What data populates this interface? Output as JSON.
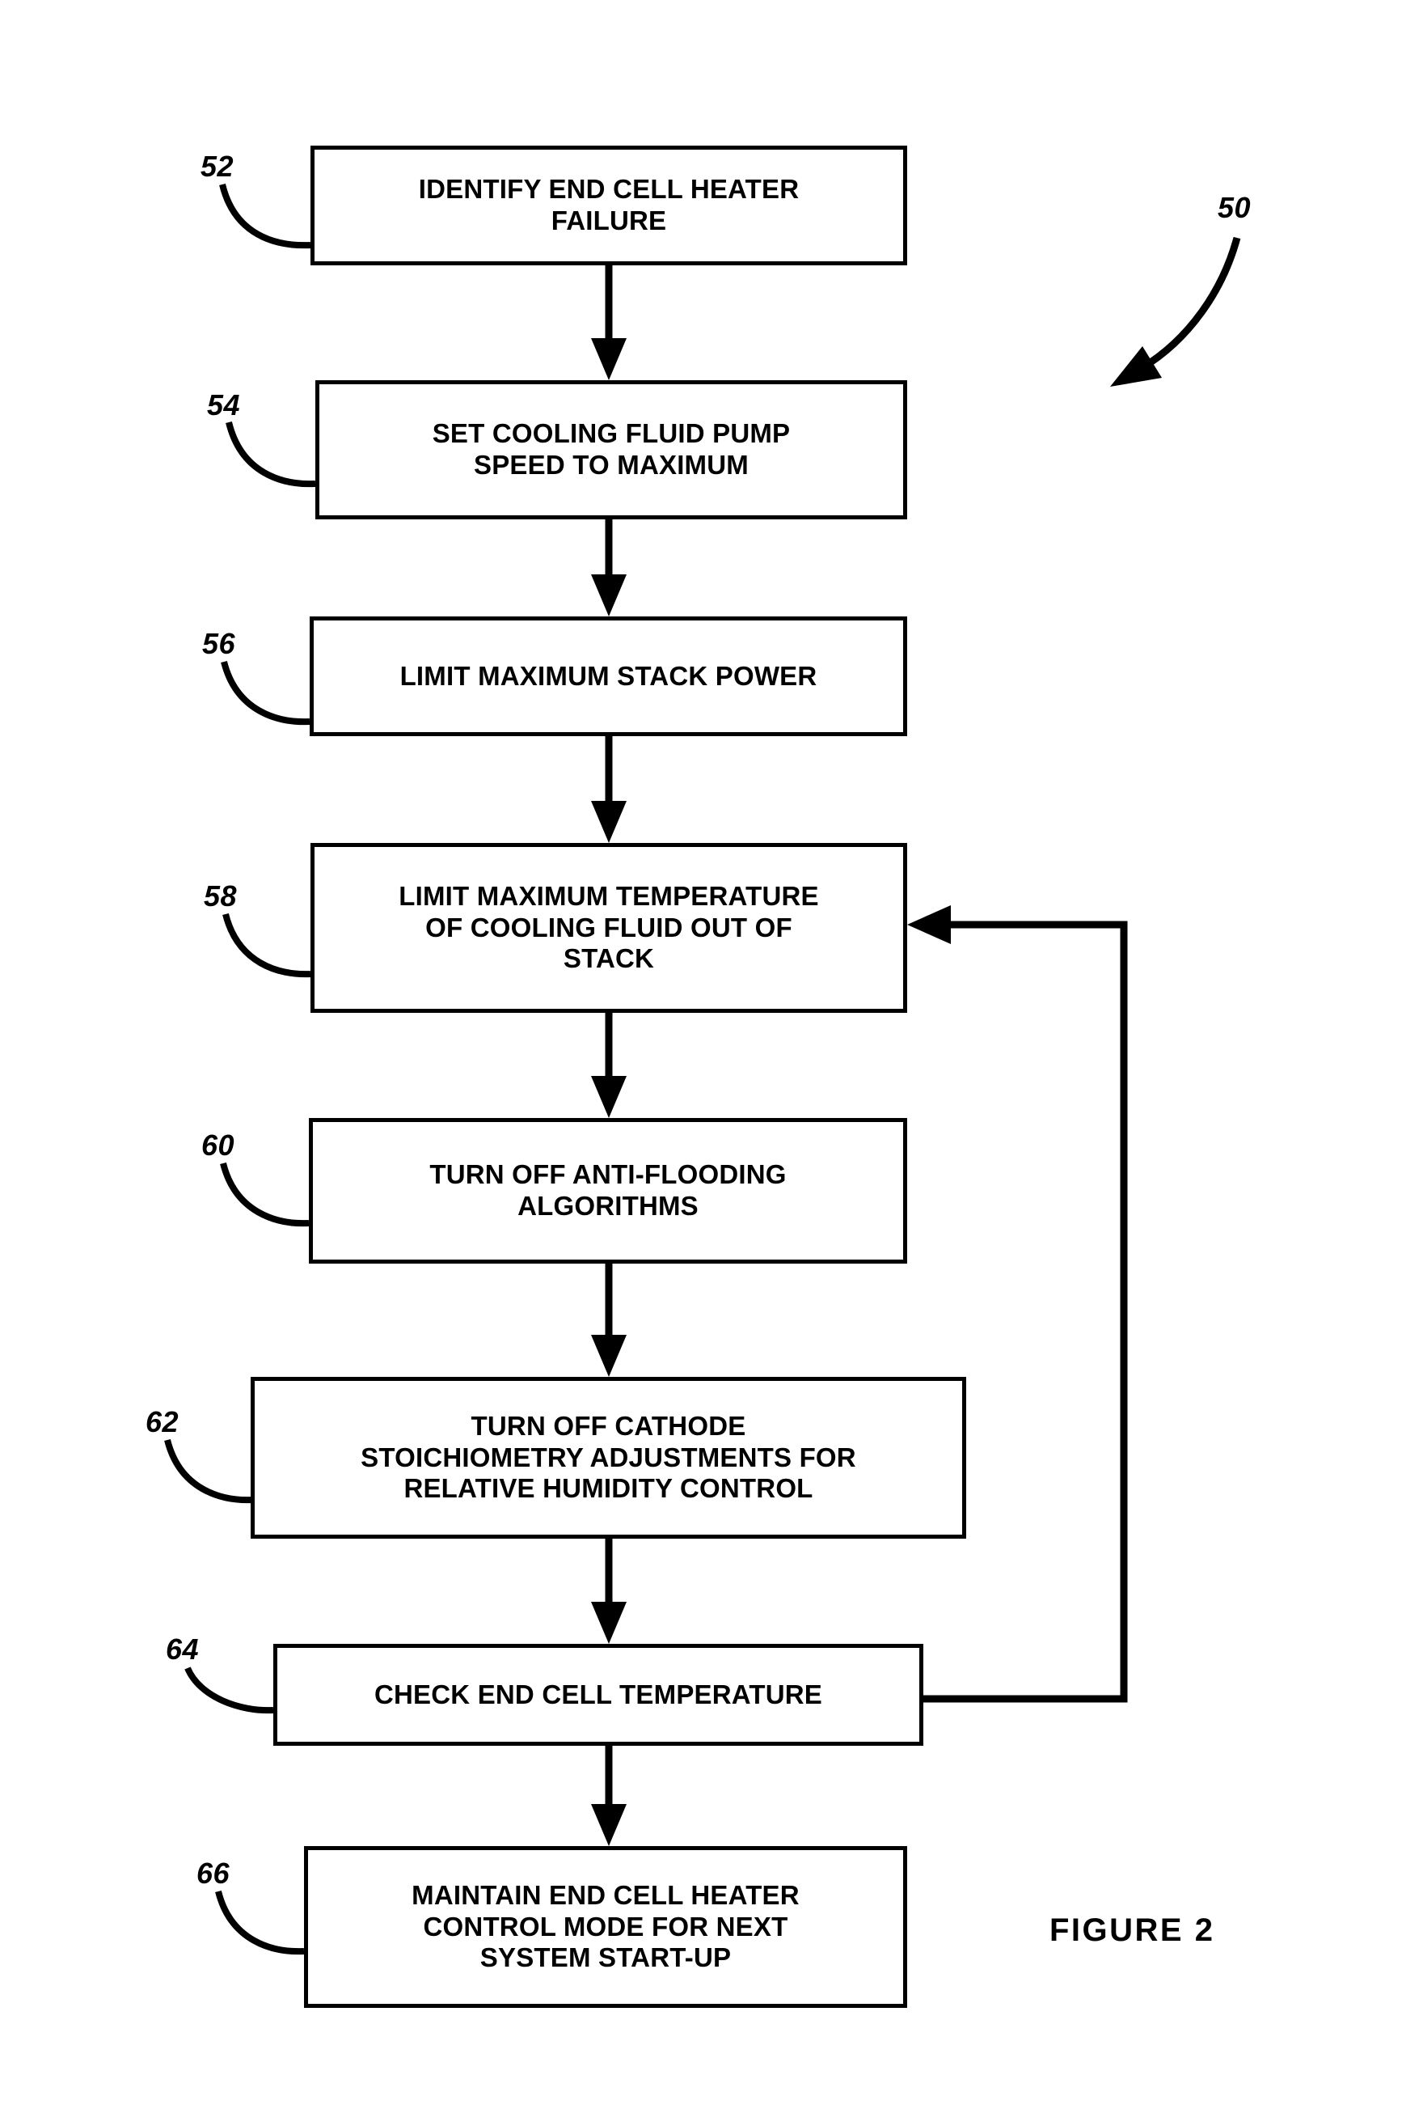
{
  "figure": {
    "caption": "FIGURE  2",
    "overall_reference": "50"
  },
  "flowchart": {
    "type": "flowchart",
    "orientation": "top-to-bottom",
    "steps": [
      {
        "ref": "52",
        "text": "IDENTIFY END CELL HEATER\nFAILURE",
        "lines": [
          "IDENTIFY END CELL HEATER",
          "FAILURE"
        ]
      },
      {
        "ref": "54",
        "text": "SET COOLING FLUID PUMP\nSPEED TO MAXIMUM",
        "lines": [
          "SET COOLING FLUID PUMP",
          "SPEED TO MAXIMUM"
        ]
      },
      {
        "ref": "56",
        "text": "LIMIT MAXIMUM STACK POWER",
        "lines": [
          "LIMIT MAXIMUM STACK POWER"
        ]
      },
      {
        "ref": "58",
        "text": "LIMIT MAXIMUM TEMPERATURE\nOF COOLING FLUID OUT OF\nSTACK",
        "lines": [
          "LIMIT MAXIMUM TEMPERATURE",
          "OF COOLING FLUID OUT OF",
          "STACK"
        ]
      },
      {
        "ref": "60",
        "text": "TURN OFF ANTI-FLOODING\nALGORITHMS",
        "lines": [
          "TURN OFF ANTI-FLOODING",
          "ALGORITHMS"
        ]
      },
      {
        "ref": "62",
        "text": "TURN OFF CATHODE\nSTOICHIOMETRY ADJUSTMENTS FOR\nRELATIVE HUMIDITY CONTROL",
        "lines": [
          "TURN OFF CATHODE",
          "STOICHIOMETRY ADJUSTMENTS FOR",
          "RELATIVE HUMIDITY CONTROL"
        ]
      },
      {
        "ref": "64",
        "text": "CHECK END CELL TEMPERATURE",
        "lines": [
          "CHECK END CELL TEMPERATURE"
        ]
      },
      {
        "ref": "66",
        "text": "MAINTAIN END CELL HEATER\nCONTROL MODE FOR NEXT\nSYSTEM START-UP",
        "lines": [
          "MAINTAIN END CELL HEATER",
          "CONTROL MODE FOR NEXT",
          "SYSTEM START-UP"
        ]
      }
    ],
    "connections": [
      {
        "from": "52",
        "to": "54",
        "kind": "down-arrow"
      },
      {
        "from": "54",
        "to": "56",
        "kind": "down-arrow"
      },
      {
        "from": "56",
        "to": "58",
        "kind": "down-arrow"
      },
      {
        "from": "58",
        "to": "60",
        "kind": "down-arrow"
      },
      {
        "from": "60",
        "to": "62",
        "kind": "down-arrow"
      },
      {
        "from": "62",
        "to": "64",
        "kind": "down-arrow"
      },
      {
        "from": "64",
        "to": "66",
        "kind": "down-arrow"
      },
      {
        "from": "64",
        "to": "58",
        "kind": "feedback-loop-right"
      }
    ]
  },
  "colors": {
    "ink": "#000000",
    "paper": "#ffffff"
  }
}
